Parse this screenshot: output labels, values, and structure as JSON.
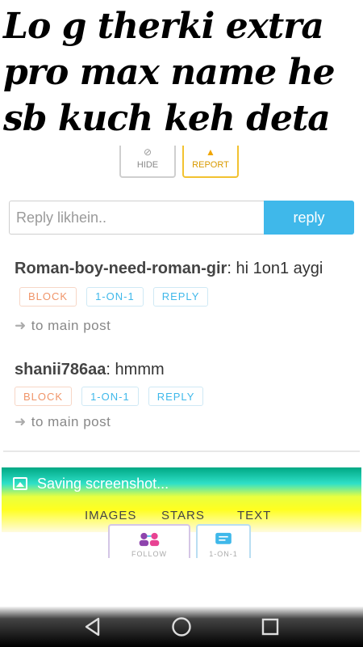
{
  "meme_caption": {
    "line1": "Lo g therki extra",
    "line2": "pro max name he",
    "line3": "sb kuch keh deta"
  },
  "post_actions": {
    "hide_label": "HIDE",
    "report_label": "REPORT"
  },
  "reply_box": {
    "placeholder": "Reply likhein..",
    "button_label": "reply"
  },
  "comments": [
    {
      "author": "Roman-boy-need-roman-gir",
      "separator": ":",
      "text": " hi 1on1 aygi",
      "block_label": "BLOCK",
      "one_on_one_label": "1-ON-1",
      "reply_label": "REPLY",
      "main_post_label": "to main post"
    },
    {
      "author": "shanii786aa",
      "separator": ":",
      "text": " hmmm",
      "block_label": "BLOCK",
      "one_on_one_label": "1-ON-1",
      "reply_label": "REPLY",
      "main_post_label": "to main post"
    }
  ],
  "notification": {
    "text": "Saving screenshot...",
    "icon": "image-icon"
  },
  "tabs": [
    "IMAGES",
    "STARS",
    "TEXT"
  ],
  "cards": {
    "follow_label": "FOLLOW",
    "one_on_one_label": "1-ON-1"
  },
  "colors": {
    "accent_blue": "#3fb8ea",
    "block_orange": "#f0956a",
    "report_yellow": "#f2c230"
  },
  "nav": {
    "back_icon": "back-triangle-icon",
    "home_icon": "home-circle-icon",
    "recents_icon": "recents-square-icon"
  }
}
